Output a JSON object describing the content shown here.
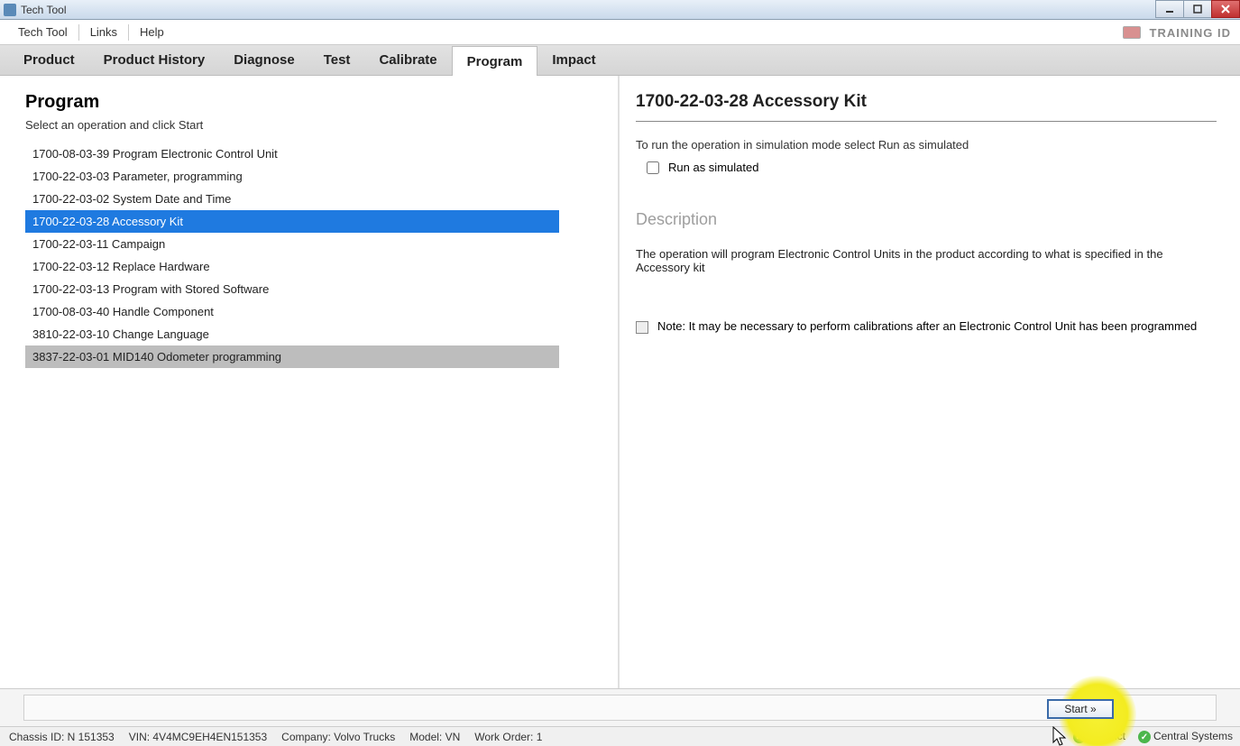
{
  "window": {
    "title": "Tech Tool"
  },
  "menu": {
    "items": [
      "Tech Tool",
      "Links",
      "Help"
    ],
    "training_label": "TRAINING ID"
  },
  "tabs": {
    "items": [
      "Product",
      "Product History",
      "Diagnose",
      "Test",
      "Calibrate",
      "Program",
      "Impact"
    ],
    "active_index": 5
  },
  "left": {
    "heading": "Program",
    "subtitle": "Select an operation and click Start",
    "operations": [
      "1700-08-03-39 Program Electronic Control Unit",
      "1700-22-03-03 Parameter, programming",
      "1700-22-03-02 System Date and Time",
      "1700-22-03-28 Accessory Kit",
      "1700-22-03-11 Campaign",
      "1700-22-03-12 Replace Hardware",
      "1700-22-03-13 Program with Stored Software",
      "1700-08-03-40 Handle Component",
      "3810-22-03-10 Change Language",
      "3837-22-03-01 MID140 Odometer programming"
    ],
    "selected_index": 3,
    "hover_index": 9
  },
  "right": {
    "heading": "1700-22-03-28 Accessory Kit",
    "instruction": "To run the operation in simulation mode select Run as simulated",
    "checkbox_label": "Run as simulated",
    "section_label": "Description",
    "description": "The operation will program Electronic Control Units in the product according to what is specified in the Accessory kit",
    "note": "Note: It may be necessary to perform calibrations after an Electronic Control Unit has been programmed"
  },
  "buttons": {
    "start": "Start »"
  },
  "status": {
    "chassis": "Chassis ID: N 151353",
    "vin": "VIN: 4V4MC9EH4EN151353",
    "company": "Company: Volvo Trucks",
    "model": "Model: VN",
    "work_order": "Work Order: 1",
    "product": "Product",
    "central": "Central Systems"
  }
}
